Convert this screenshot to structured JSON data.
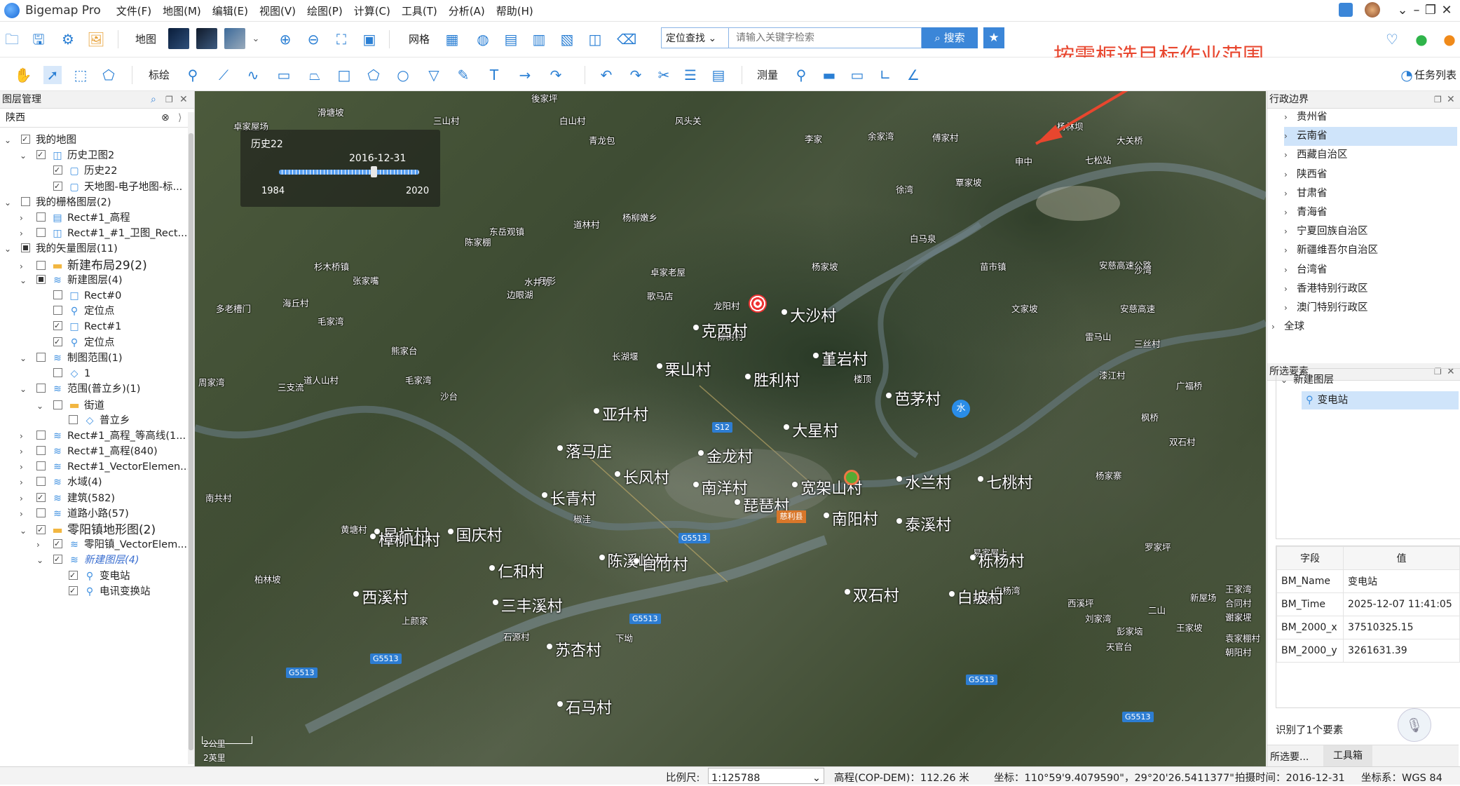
{
  "app": {
    "title": "Bigemap Pro"
  },
  "menu": [
    "文件(F)",
    "地图(M)",
    "编辑(E)",
    "视图(V)",
    "绘图(P)",
    "计算(C)",
    "工具(T)",
    "分析(A)",
    "帮助(H)"
  ],
  "toolbar1": {
    "map_label": "地图",
    "grid_label": "网格",
    "locate_select": "定位查找",
    "search_placeholder": "请输入关键字检索",
    "search_button": "搜索"
  },
  "toolbar2": {
    "mark_label": "标绘",
    "measure_label": "测量",
    "task_list": "任务列表"
  },
  "annotation": "按需框选目标作业范围",
  "left_panel": {
    "title": "图层管理",
    "filter_value": "陕西",
    "tree": [
      {
        "label": "我的地图",
        "checked": "on",
        "expanded": true,
        "level": 0,
        "icon": "none"
      },
      {
        "label": "历史卫图2",
        "checked": "on",
        "expanded": true,
        "level": 1,
        "icon": "map"
      },
      {
        "label": "历史22",
        "checked": "on",
        "level": 2,
        "icon": "page"
      },
      {
        "label": "天地图-电子地图-标...",
        "checked": "on",
        "level": 2,
        "icon": "page"
      },
      {
        "label": "我的栅格图层(2)",
        "checked": "off",
        "expanded": true,
        "level": 0,
        "icon": "none"
      },
      {
        "label": "Rect#1_高程",
        "checked": "off",
        "expanded": false,
        "level": 1,
        "icon": "raster"
      },
      {
        "label": "Rect#1_#1_卫图_Rect...",
        "checked": "off",
        "expanded": false,
        "level": 1,
        "icon": "map"
      },
      {
        "label": "我的矢量图层(11)",
        "checked": "part",
        "expanded": true,
        "level": 0,
        "icon": "none"
      },
      {
        "label": "新建布局29(2)",
        "checked": "off",
        "expanded": false,
        "level": 1,
        "icon": "folder"
      },
      {
        "label": "新建图层(4)",
        "checked": "part",
        "expanded": true,
        "level": 1,
        "icon": "layers"
      },
      {
        "label": "Rect#0",
        "checked": "off",
        "level": 2,
        "icon": "rect"
      },
      {
        "label": "定位点",
        "checked": "off",
        "level": 2,
        "icon": "pin"
      },
      {
        "label": "Rect#1",
        "checked": "on",
        "level": 2,
        "icon": "rect"
      },
      {
        "label": "定位点",
        "checked": "on",
        "level": 2,
        "icon": "pin"
      },
      {
        "label": "制图范围(1)",
        "checked": "off",
        "expanded": true,
        "level": 1,
        "icon": "layers"
      },
      {
        "label": "1",
        "checked": "off",
        "level": 2,
        "icon": "poly"
      },
      {
        "label": "范围(普立乡)(1)",
        "checked": "off",
        "expanded": true,
        "level": 1,
        "icon": "layers"
      },
      {
        "label": "街道",
        "checked": "off",
        "expanded": true,
        "level": 2,
        "icon": "folder"
      },
      {
        "label": "普立乡",
        "checked": "off",
        "level": 3,
        "icon": "poly"
      },
      {
        "label": "Rect#1_高程_等高线(1...",
        "checked": "off",
        "expanded": false,
        "level": 1,
        "icon": "layers"
      },
      {
        "label": "Rect#1_高程(840)",
        "checked": "off",
        "expanded": false,
        "level": 1,
        "icon": "layers"
      },
      {
        "label": "Rect#1_VectorElemen...",
        "checked": "off",
        "expanded": false,
        "level": 1,
        "icon": "layers"
      },
      {
        "label": "水域(4)",
        "checked": "off",
        "expanded": false,
        "level": 1,
        "icon": "layers"
      },
      {
        "label": "建筑(582)",
        "checked": "on",
        "expanded": false,
        "level": 1,
        "icon": "layers"
      },
      {
        "label": "道路小路(57)",
        "checked": "off",
        "expanded": false,
        "level": 1,
        "icon": "layers"
      },
      {
        "label": "零阳镇地形图(2)",
        "checked": "on",
        "expanded": true,
        "level": 1,
        "icon": "folder"
      },
      {
        "label": "零阳镇_VectorElem...",
        "checked": "on",
        "expanded": false,
        "level": 2,
        "icon": "layers"
      },
      {
        "label": "新建图层(4)",
        "checked": "on",
        "expanded": true,
        "level": 2,
        "icon": "layers"
      },
      {
        "label": "变电站",
        "checked": "on",
        "level": 3,
        "icon": "pin"
      },
      {
        "label": "电讯变换站",
        "checked": "on",
        "level": 3,
        "icon": "pin"
      }
    ]
  },
  "map": {
    "history_title": "历史22",
    "history_date": "2016-12-31",
    "year_start": "1984",
    "year_end": "2020",
    "scale_km": "2公里",
    "scale_mi": "2英里",
    "small_labels": [
      "後家坪",
      "卓家屋场",
      "滑塘坡",
      "三山村",
      "白山村",
      "风头关",
      "青龙包",
      "李家",
      "余家湾",
      "傅家村",
      "杨林坝",
      "大关桥",
      "申中",
      "七松站",
      "覃家坡",
      "徐湾",
      "白马泉",
      "苗市镇",
      "安慈高速公路",
      "沙湾",
      "杨柳嫩乡",
      "道林村",
      "东岳观镇",
      "陈家棚",
      "杉木桥镇",
      "月形",
      "边眼湖",
      "张家嘴",
      "海丘村",
      "多老槽门",
      "毛家湾",
      "水井坊",
      "卓家老屋",
      "歌马店",
      "龙阳村",
      "文家坡",
      "安慈高速",
      "杨家坡",
      "雷马山",
      "柳树村",
      "三丝村",
      "熊家台",
      "长湖堰",
      "道人山村",
      "周家湾",
      "毛家湾",
      "楼顶",
      "漆江村",
      "沙台",
      "三支流",
      "广福桥",
      "枫桥",
      "双石村",
      "南共村",
      "椒洼",
      "杨家寨",
      "柏林坡",
      "二山",
      "易家屋上",
      "罗家坪",
      "黄塘村",
      "白杨湾",
      "西溪坪",
      "彭家垴",
      "上颜家",
      "石源村",
      "下坳",
      "熊家垭",
      "刘家湾",
      "新屋场",
      "王家坡",
      "天官台",
      "长安坡",
      "袁家棚村",
      "朝阳村",
      "谢家坪",
      "合同村",
      "王家湾"
    ],
    "big_labels": [
      "克西村",
      "大沙村",
      "栗山村",
      "胜利村",
      "堇岩村",
      "芭茅村",
      "亚升村",
      "金龙村",
      "大星村",
      "落马庄",
      "长风村",
      "南洋村",
      "长青村",
      "宽架山村",
      "水兰村",
      "七桃村",
      "星坑村",
      "琵琶村",
      "南阳村",
      "泰溪村",
      "仁和村",
      "陈溪峪村",
      "栎杨村",
      "西溪村",
      "三丰溪村",
      "白坡村",
      "苏杏村",
      "双石村",
      "白竹村",
      "石马村",
      "樟柳山村",
      "国庆村"
    ],
    "road_badges": [
      "S12",
      "G5513",
      "G5513",
      "G5513",
      "G5513",
      "G5513",
      "G5513"
    ]
  },
  "right_panel": {
    "admin_title": "行政边界",
    "provinces": [
      "贵州省",
      "云南省",
      "西藏自治区",
      "陕西省",
      "甘肃省",
      "青海省",
      "宁夏回族自治区",
      "新疆维吾尔自治区",
      "台湾省",
      "香港特别行政区",
      "澳门特别行政区",
      "全球"
    ],
    "selected_province": "云南省",
    "selection_title": "所选要素",
    "selection_group": "新建图层",
    "selection_item": "变电站",
    "attr_headers": [
      "字段",
      "值"
    ],
    "attr_rows": [
      [
        "BM_Name",
        "变电站"
      ],
      [
        "BM_Time",
        "2025-12-07 11:41:05"
      ],
      [
        "BM_2000_x",
        "37510325.15"
      ],
      [
        "BM_2000_y",
        "3261631.39"
      ]
    ],
    "identified": "识别了1个要素",
    "tabs": [
      "所选要...",
      "工具箱"
    ]
  },
  "status": {
    "scale_label": "比例尺:",
    "scale_value": "1:125788",
    "elevation": "高程(COP-DEM)：112.26 米",
    "coords": "坐标：110°59'9.4079590\"，29°20'26.5411377\"",
    "photo_time": "拍摄时间：2016-12-31",
    "crs": "坐标系：WGS 84"
  },
  "colors": {
    "accent": "#3b86d8",
    "annotation": "#e8462e",
    "selection": "#cfe4fa"
  },
  "icons": [
    "pan-icon",
    "select-icon",
    "zoom-in-icon",
    "zoom-out-icon",
    "point-icon",
    "line-icon",
    "rectangle-icon",
    "polygon-icon",
    "circle-icon",
    "text-icon",
    "arrow-icon",
    "undo-icon",
    "redo-icon",
    "scissors-icon",
    "measure-pin-icon",
    "target-marker-icon"
  ]
}
